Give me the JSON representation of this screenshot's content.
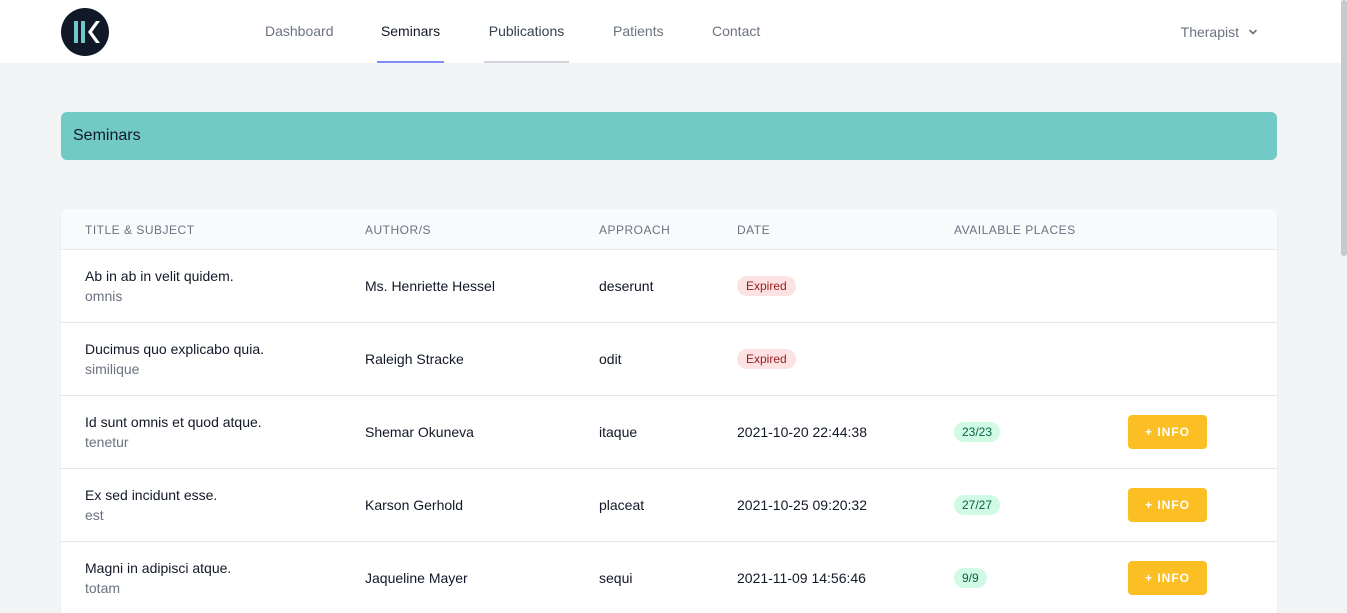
{
  "nav": {
    "items": [
      {
        "label": "Dashboard"
      },
      {
        "label": "Seminars"
      },
      {
        "label": "Publications"
      },
      {
        "label": "Patients"
      },
      {
        "label": "Contact"
      }
    ],
    "user_menu_label": "Therapist"
  },
  "page": {
    "section_title": "Seminars"
  },
  "table": {
    "headers": [
      "TITLE & SUBJECT",
      "AUTHOR/S",
      "APPROACH",
      "DATE",
      "AVAILABLE PLACES"
    ],
    "rows": [
      {
        "title": "Ab in ab in velit quidem.",
        "subject": "omnis",
        "author": "Ms. Henriette Hessel",
        "approach": "deserunt",
        "date": "Expired",
        "places": "",
        "action": ""
      },
      {
        "title": "Ducimus quo explicabo quia.",
        "subject": "similique",
        "author": "Raleigh Stracke",
        "approach": "odit",
        "date": "Expired",
        "places": "",
        "action": ""
      },
      {
        "title": "Id sunt omnis et quod atque.",
        "subject": "tenetur",
        "author": "Shemar Okuneva",
        "approach": "itaque",
        "date": "2021-10-20 22:44:38",
        "places": "23/23",
        "action": "+ INFO"
      },
      {
        "title": "Ex sed incidunt esse.",
        "subject": "est",
        "author": "Karson Gerhold",
        "approach": "placeat",
        "date": "2021-10-25 09:20:32",
        "places": "27/27",
        "action": "+ INFO"
      },
      {
        "title": "Magni in adipisci atque.",
        "subject": "totam",
        "author": "Jaqueline Mayer",
        "approach": "sequi",
        "date": "2021-11-09 14:56:46",
        "places": "9/9",
        "action": "+ INFO"
      }
    ]
  },
  "colors": {
    "header_accent": "#72cac7",
    "active_tab": "#818cf8",
    "info_button": "#fbbf24",
    "expired_badge": "#fde2e4",
    "places_badge": "#d1fae5"
  }
}
